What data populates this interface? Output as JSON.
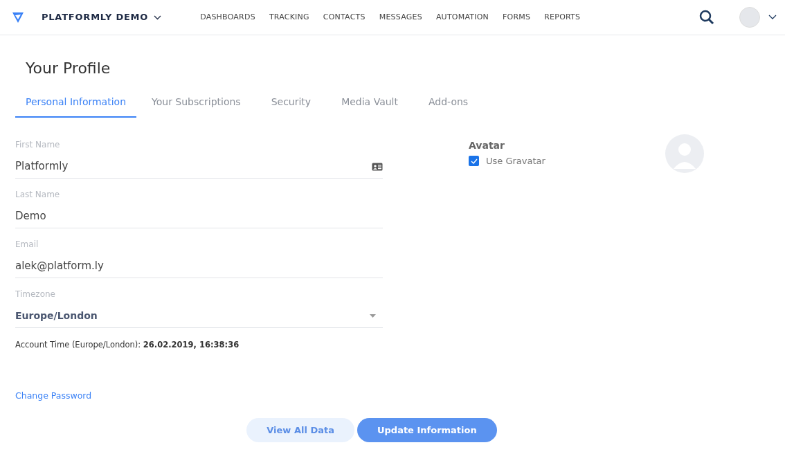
{
  "header": {
    "workspace": "PLATFORMLY DEMO",
    "nav": [
      {
        "label": "DASHBOARDS"
      },
      {
        "label": "TRACKING"
      },
      {
        "label": "CONTACTS"
      },
      {
        "label": "MESSAGES"
      },
      {
        "label": "AUTOMATION"
      },
      {
        "label": "FORMS"
      },
      {
        "label": "REPORTS"
      }
    ]
  },
  "title": "Your Profile",
  "tabs": [
    {
      "label": "Personal Information",
      "selected": true
    },
    {
      "label": "Your Subscriptions",
      "selected": false
    },
    {
      "label": "Security",
      "selected": false
    },
    {
      "label": "Media Vault",
      "selected": false
    },
    {
      "label": "Add-ons",
      "selected": false
    }
  ],
  "fields": [
    {
      "kind": "card",
      "label": "First Name",
      "value": "Platformly"
    },
    {
      "kind": "text",
      "label": "Last Name",
      "value": "Demo"
    },
    {
      "kind": "text",
      "label": "Email",
      "value": "alek@platform.ly"
    },
    {
      "kind": "select",
      "label": "Timezone",
      "value": "Europe/London"
    }
  ],
  "account_time": "Account Time (Europe/London): **26.02.2019, 16:38:36**",
  "avatar": {
    "heading": "Avatar",
    "checkbox": {
      "label": "Use Gravatar",
      "checked": true
    }
  },
  "change_password": "Change Password",
  "buttons": [
    {
      "kind": "secondary",
      "label": "View All Data"
    },
    {
      "kind": "primary",
      "label": "Update Information"
    }
  ]
}
